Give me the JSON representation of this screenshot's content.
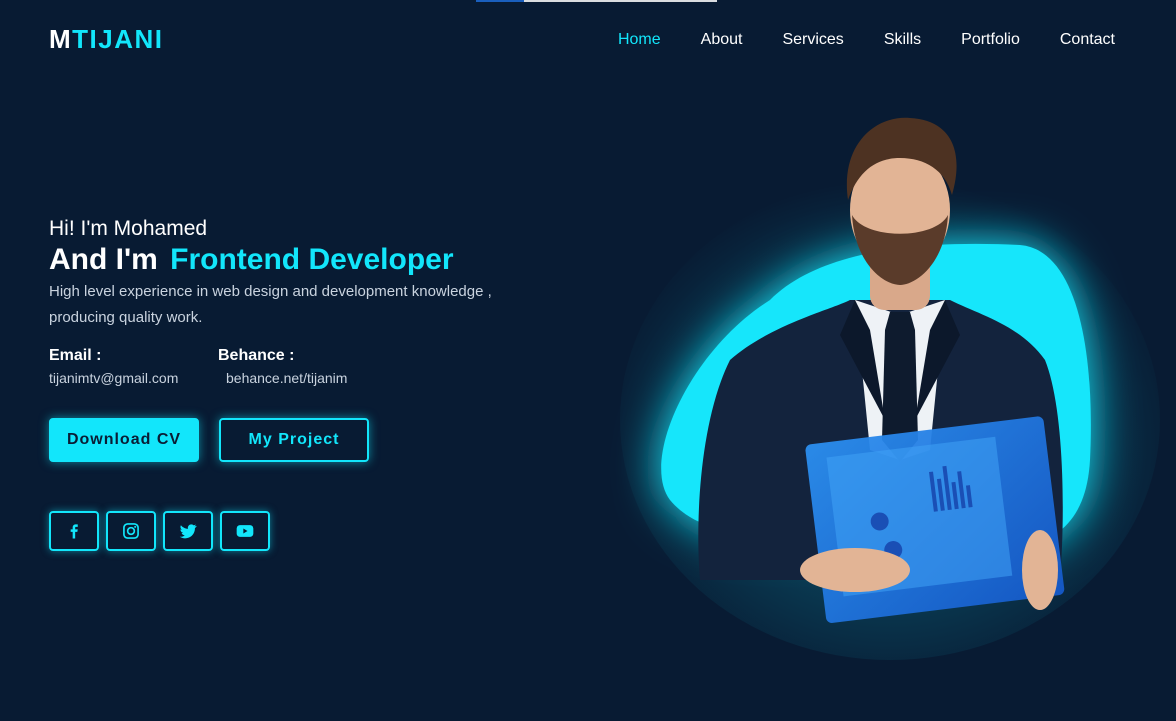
{
  "header": {
    "logo_part1": "M",
    "logo_part2": "TIJANI",
    "nav": [
      {
        "label": "Home",
        "active": true
      },
      {
        "label": "About"
      },
      {
        "label": "Services"
      },
      {
        "label": "Skills"
      },
      {
        "label": "Portfolio"
      },
      {
        "label": "Contact"
      }
    ]
  },
  "hero": {
    "greeting": "Hi! I'm Mohamed",
    "role_prefix": "And I'm",
    "role_accent": "Frontend Developer",
    "description": "High level experience in web design and development knowledge , producing quality work.",
    "email_label": "Email :",
    "email_value": "tijanimtv@gmail.com",
    "behance_label": "Behance :",
    "behance_value": "behance.net/tijanim",
    "download_cv": "Download CV",
    "my_project": "My Project",
    "socials": [
      "facebook-icon",
      "instagram-icon",
      "twitter-icon",
      "youtube-icon"
    ]
  },
  "colors": {
    "background": "#081b33",
    "accent": "#12e6fb",
    "text": "#ffffff",
    "muted": "#c9d3df"
  }
}
